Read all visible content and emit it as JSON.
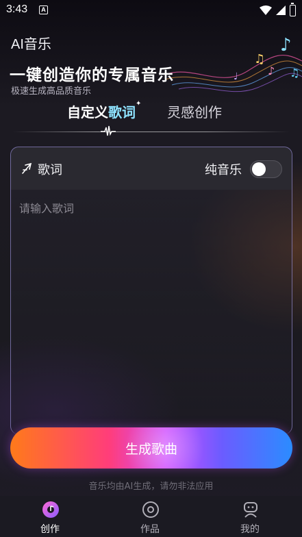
{
  "status_bar": {
    "time": "3:43",
    "notification_badge": "A"
  },
  "header": {
    "app_title": "AI音乐",
    "headline": "一键创造你的专属音乐",
    "subheadline": "极速生成高品质音乐"
  },
  "tabs": {
    "lyrics_prefix": "自定义",
    "lyrics_highlight": "歌词",
    "inspiration": "灵感创作",
    "active": "自定义歌词"
  },
  "panel": {
    "lyrics_label": "歌词",
    "pure_music_label": "纯音乐",
    "pure_music_on": false,
    "input_placeholder": "请输入歌词",
    "input_value": ""
  },
  "generate_button": {
    "label": "生成歌曲"
  },
  "disclaimer": "音乐均由AI生成，请勿非法应用",
  "bottom_nav": [
    {
      "label": "创作",
      "icon": "music-disc-icon",
      "active": true
    },
    {
      "label": "作品",
      "icon": "record-icon",
      "active": false
    },
    {
      "label": "我的",
      "icon": "robot-profile-icon",
      "active": false
    }
  ],
  "colors": {
    "accent_cyan": "#8ee3ff",
    "button_gradient": [
      "#ff7a1a",
      "#ff3d7a",
      "#d04dff",
      "#6b5cff",
      "#2b8cff"
    ],
    "background": "#17161c",
    "nav_active_icon": "#c85cff"
  }
}
